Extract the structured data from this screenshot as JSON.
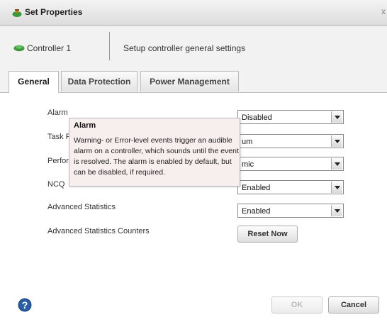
{
  "dialog": {
    "title": "Set Properties",
    "close_glyph": "x"
  },
  "header": {
    "controller_name": "Controller 1",
    "description": "Setup controller general settings"
  },
  "tabs": [
    {
      "label": "General",
      "active": true
    },
    {
      "label": "Data Protection",
      "active": false
    },
    {
      "label": "Power Management",
      "active": false
    }
  ],
  "general": {
    "alarm": {
      "label": "Alarm",
      "value": "Disabled"
    },
    "task_priority": {
      "label": "Task P",
      "value": "um"
    },
    "performance": {
      "label": "Perfor",
      "value": "mic"
    },
    "ncq": {
      "label": "NCQ",
      "value": "Enabled"
    },
    "advanced_statistics": {
      "label": "Advanced Statistics",
      "value": "Enabled"
    },
    "advanced_statistics_counters": {
      "label": "Advanced Statistics Counters",
      "button": "Reset Now"
    }
  },
  "tooltip": {
    "title": "Alarm",
    "body": "Warning- or Error-level events trigger an audible alarm on a controller, which sounds until the event is resolved. The alarm is enabled by default, but can be disabled, if required."
  },
  "footer": {
    "ok_label": "OK",
    "cancel_label": "Cancel"
  },
  "icons": {
    "controller": "controller-icon",
    "help": "help-icon"
  },
  "colors": {
    "accent_green": "#3a9a3a",
    "help_blue": "#1d4a86",
    "tooltip_bg": "#f7eeee"
  }
}
